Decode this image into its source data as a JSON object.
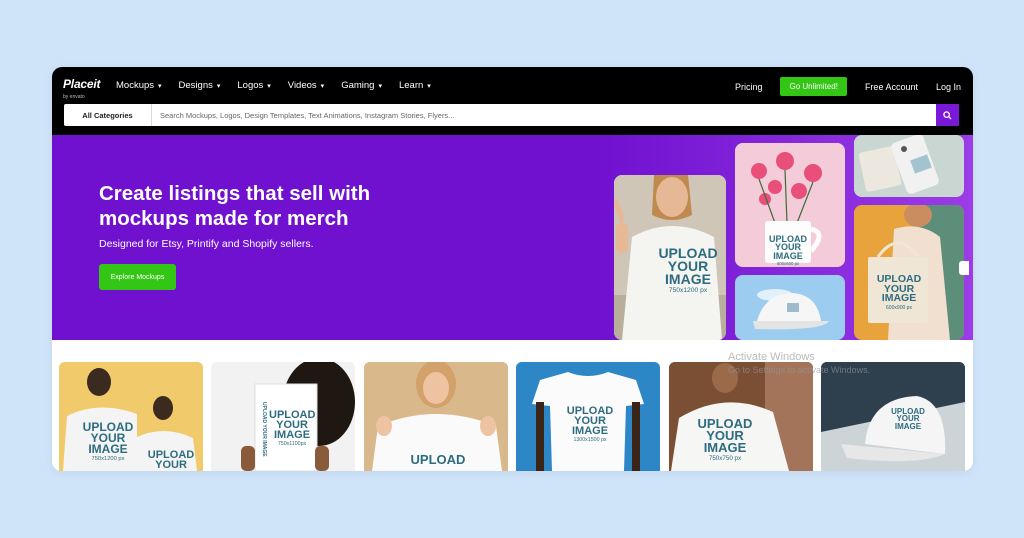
{
  "nav": {
    "logo": "Placeit",
    "logo_sub": "by envato",
    "menu": [
      {
        "label": "Mockups"
      },
      {
        "label": "Designs"
      },
      {
        "label": "Logos"
      },
      {
        "label": "Videos"
      },
      {
        "label": "Gaming"
      },
      {
        "label": "Learn"
      }
    ],
    "pricing": "Pricing",
    "go_unlimited": "Go Unlimited!",
    "free_account": "Free Account",
    "login": "Log In"
  },
  "search": {
    "category": "All Categories",
    "placeholder": "Search Mockups, Logos, Design Templates, Text Animations, Instagram Stories, Flyers..."
  },
  "hero": {
    "title": "Create listings that sell with mockups made for merch",
    "subtitle": "Designed for Etsy, Printify and Shopify sellers.",
    "button": "Explore Mockups"
  },
  "hero_tiles": {
    "tshirt": {
      "line1": "UPLOAD",
      "line2": "YOUR",
      "line3": "IMAGE",
      "size": "750x1200 px"
    },
    "mug": {
      "line1": "UPLOAD",
      "line2": "YOUR",
      "line3": "IMAGE",
      "size": "600x600 px"
    },
    "tote": {
      "line1": "UPLOAD",
      "line2": "YOUR",
      "line3": "IMAGE",
      "size": "600x900 px"
    }
  },
  "thumbs": [
    {
      "lines": [
        "UPLOAD",
        "YOUR",
        "IMAGE"
      ],
      "size": "750x1200 px",
      "lines2": [
        "UPLOAD",
        "YOUR"
      ]
    },
    {
      "lines": [
        "UPLOAD",
        "YOUR",
        "IMAGE"
      ],
      "size": "750x1100px",
      "side": "UPLOAD YOUR IMAGE"
    },
    {
      "lines": [
        "UPLOAD"
      ]
    },
    {
      "lines": [
        "UPLOAD",
        "YOUR",
        "IMAGE"
      ],
      "size": "1300x1500 px"
    },
    {
      "lines": [
        "UPLOAD",
        "YOUR",
        "IMAGE"
      ],
      "size": "750x750 px"
    },
    {
      "lines": [
        "UPLOAD",
        "YOUR",
        "IMAGE"
      ]
    }
  ],
  "watermark": {
    "line1": "Activate Windows",
    "line2": "Go to Settings to activate Windows."
  },
  "colors": {
    "accent": "#6f11cf",
    "button_green": "#34c615",
    "nav_bg": "#000000",
    "search_btn": "#7a18d8",
    "page_bg": "#cfe3f9",
    "upload_text": "#2d6c80"
  }
}
